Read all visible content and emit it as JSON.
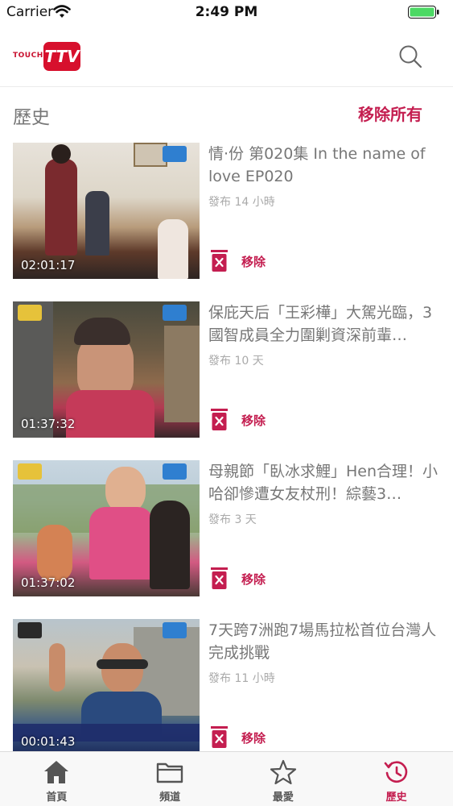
{
  "status_bar": {
    "carrier": "Carrier",
    "time": "2:49 PM"
  },
  "header": {
    "logo_touch": "TOUCH",
    "logo_ttv": "TTV",
    "search_icon": "search-icon"
  },
  "section": {
    "title": "歷史",
    "remove_all": "移除所有"
  },
  "history": [
    {
      "title": "情·份 第020集 In the name of love EP020",
      "meta": "發布 14 小時",
      "duration": "02:01:17",
      "remove_label": "移除"
    },
    {
      "title": "保庇天后「王彩樺」大駕光臨，3國智成員全力圍剿資深前輩…",
      "meta": "發布 10 天",
      "duration": "01:37:32",
      "remove_label": "移除"
    },
    {
      "title": "母親節「臥冰求鯉」Hen合理！小哈卻慘遭女友杖刑！綜藝3…",
      "meta": "發布 3 天",
      "duration": "01:37:02",
      "remove_label": "移除"
    },
    {
      "title": "7天跨7洲跑7場馬拉松首位台灣人完成挑戰",
      "meta": "發布 11 小時",
      "duration": "00:01:43",
      "remove_label": "移除"
    }
  ],
  "tabs": [
    {
      "label": "首頁",
      "icon": "home-icon",
      "active": false
    },
    {
      "label": "頻道",
      "icon": "folder-icon",
      "active": false
    },
    {
      "label": "最愛",
      "icon": "star-icon",
      "active": false
    },
    {
      "label": "歷史",
      "icon": "history-icon",
      "active": true
    }
  ],
  "colors": {
    "accent": "#c41e50",
    "logo_red": "#d7102d",
    "battery_green": "#4cd964"
  }
}
